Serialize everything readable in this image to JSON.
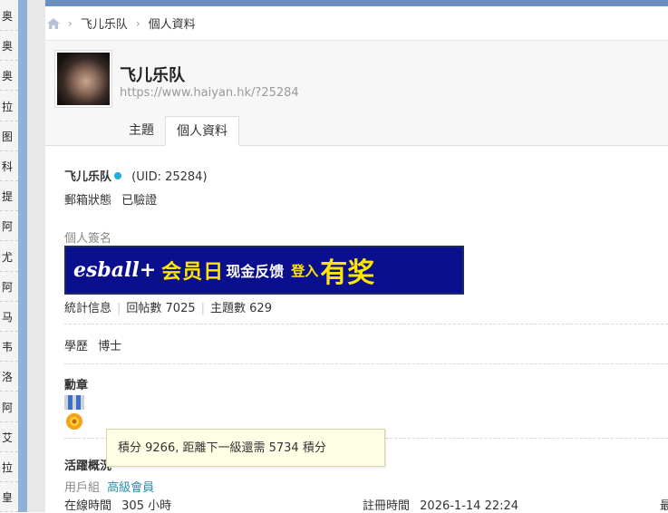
{
  "left_strip": {
    "items": [
      "奥",
      "奥",
      "奥",
      "拉",
      "图",
      "科",
      "提",
      "阿",
      "尤",
      "阿",
      "马",
      "韦",
      "洛",
      "阿",
      "艾",
      "拉",
      "皇"
    ]
  },
  "breadcrumb": {
    "home_icon": "home-icon",
    "items": [
      "飞儿乐队",
      "個人資料"
    ]
  },
  "profile": {
    "name": "飞儿乐队",
    "url": "https://www.haiyan.hk/?25284"
  },
  "tabs": [
    "主題",
    "個人資料"
  ],
  "content": {
    "name": "飞儿乐队",
    "uid": "(UID: 25284)",
    "email_label": "郵箱狀態",
    "email_value": "已驗證",
    "signature_label": "個人簽名",
    "banner": {
      "brand": "esball+",
      "text1": "会员日",
      "text2": "现金反馈",
      "text3": "登入",
      "text4": "有奖"
    },
    "stats_label": "統計信息",
    "posts_label": "回帖數 7025",
    "threads_label": "主題數 629",
    "education_label": "學歷",
    "education_value": "博士",
    "medals_label": "勳章",
    "activity_label": "活躍概況",
    "group_label": "用戶組",
    "group_value": "高級會員",
    "online_label": "在線時間",
    "online_value": "305 小時",
    "reg_label": "註冊時間",
    "reg_value": "2026-1-14 22:24",
    "cut_char": "最"
  },
  "tooltip": "積分 9266, 距離下一級還需 5734 積分",
  "colors": {
    "topbar": "#6d8fc0",
    "online_dot": "#1eaed9",
    "link": "#2a8ca8",
    "tooltip_bg": "#ffffe6"
  }
}
